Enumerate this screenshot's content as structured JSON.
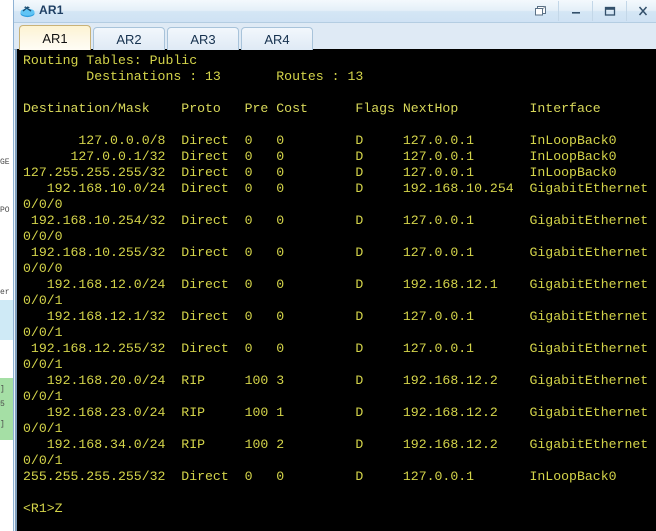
{
  "window": {
    "title": "AR1",
    "icon": "router-icon",
    "controls": [
      {
        "name": "restore-button",
        "label": "❐"
      },
      {
        "name": "minimize-button",
        "label": "—"
      },
      {
        "name": "maximize-button",
        "label": "▭"
      },
      {
        "name": "close-button",
        "label": "✕"
      }
    ]
  },
  "tabs": [
    {
      "label": "AR1",
      "active": true
    },
    {
      "label": "AR2",
      "active": false
    },
    {
      "label": "AR3",
      "active": false
    },
    {
      "label": "AR4",
      "active": false
    }
  ],
  "terminal": {
    "foreground": "#d4d44a",
    "background": "#000000",
    "routing_table_title": "Routing Tables: Public",
    "summary_line": "         Destinations : 13        Routes : 13",
    "destinations": "13",
    "routes": "13",
    "columns": [
      "Destination/Mask",
      "Proto",
      "Pre",
      "Cost",
      "Flags",
      "NextHop",
      "Interface"
    ],
    "header_line": "Destination/Mask    Proto   Pre  Cost      Flags NextHop         Interface",
    "rows": [
      {
        "destination": "127.0.0.0/8",
        "proto": "Direct",
        "pre": "0",
        "cost": "0",
        "flags": "D",
        "nexthop": "127.0.0.1",
        "interface": "InLoopBack0",
        "wrap": ""
      },
      {
        "destination": "127.0.0.1/32",
        "proto": "Direct",
        "pre": "0",
        "cost": "0",
        "flags": "D",
        "nexthop": "127.0.0.1",
        "interface": "InLoopBack0",
        "wrap": ""
      },
      {
        "destination": "127.255.255.255/32",
        "proto": "Direct",
        "pre": "0",
        "cost": "0",
        "flags": "D",
        "nexthop": "127.0.0.1",
        "interface": "InLoopBack0",
        "wrap": ""
      },
      {
        "destination": "192.168.10.0/24",
        "proto": "Direct",
        "pre": "0",
        "cost": "0",
        "flags": "D",
        "nexthop": "192.168.10.254",
        "interface": "GigabitEthernet",
        "wrap": "0/0/0"
      },
      {
        "destination": "192.168.10.254/32",
        "proto": "Direct",
        "pre": "0",
        "cost": "0",
        "flags": "D",
        "nexthop": "127.0.0.1",
        "interface": "GigabitEthernet",
        "wrap": "0/0/0"
      },
      {
        "destination": "192.168.10.255/32",
        "proto": "Direct",
        "pre": "0",
        "cost": "0",
        "flags": "D",
        "nexthop": "127.0.0.1",
        "interface": "GigabitEthernet",
        "wrap": "0/0/0"
      },
      {
        "destination": "192.168.12.0/24",
        "proto": "Direct",
        "pre": "0",
        "cost": "0",
        "flags": "D",
        "nexthop": "192.168.12.1",
        "interface": "GigabitEthernet",
        "wrap": "0/0/1"
      },
      {
        "destination": "192.168.12.1/32",
        "proto": "Direct",
        "pre": "0",
        "cost": "0",
        "flags": "D",
        "nexthop": "127.0.0.1",
        "interface": "GigabitEthernet",
        "wrap": "0/0/1"
      },
      {
        "destination": "192.168.12.255/32",
        "proto": "Direct",
        "pre": "0",
        "cost": "0",
        "flags": "D",
        "nexthop": "127.0.0.1",
        "interface": "GigabitEthernet",
        "wrap": "0/0/1"
      },
      {
        "destination": "192.168.20.0/24",
        "proto": "RIP",
        "pre": "100",
        "cost": "3",
        "flags": "D",
        "nexthop": "192.168.12.2",
        "interface": "GigabitEthernet",
        "wrap": "0/0/1"
      },
      {
        "destination": "192.168.23.0/24",
        "proto": "RIP",
        "pre": "100",
        "cost": "1",
        "flags": "D",
        "nexthop": "192.168.12.2",
        "interface": "GigabitEthernet",
        "wrap": "0/0/1"
      },
      {
        "destination": "192.168.34.0/24",
        "proto": "RIP",
        "pre": "100",
        "cost": "2",
        "flags": "D",
        "nexthop": "192.168.12.2",
        "interface": "GigabitEthernet",
        "wrap": "0/0/1"
      },
      {
        "destination": "255.255.255.255/32",
        "proto": "Direct",
        "pre": "0",
        "cost": "0",
        "flags": "D",
        "nexthop": "127.0.0.1",
        "interface": "InLoopBack0",
        "wrap": ""
      }
    ],
    "prompt": "<R1>Z"
  },
  "background_window": {
    "strips": [
      "GE",
      "PO",
      "er",
      "]",
      "5",
      "]"
    ]
  }
}
